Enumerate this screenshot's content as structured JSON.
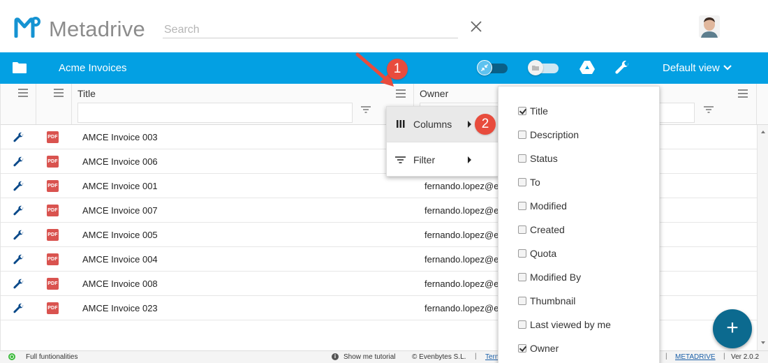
{
  "app": {
    "name": "Metadrive",
    "search_placeholder": "Search"
  },
  "toolbar": {
    "library_title": "Acme Invoices",
    "view_label": "Default view"
  },
  "grid": {
    "columns": {
      "title": "Title",
      "owner": "Owner"
    },
    "rows": [
      {
        "title": "AMCE Invoice 003",
        "owner": ""
      },
      {
        "title": "AMCE Invoice 006",
        "owner": ""
      },
      {
        "title": "AMCE Invoice 001",
        "owner": "fernando.lopez@e"
      },
      {
        "title": "AMCE Invoice 007",
        "owner": "fernando.lopez@e"
      },
      {
        "title": "AMCE Invoice 005",
        "owner": "fernando.lopez@e"
      },
      {
        "title": "AMCE Invoice 004",
        "owner": "fernando.lopez@e"
      },
      {
        "title": "AMCE Invoice 008",
        "owner": "fernando.lopez@e"
      },
      {
        "title": "AMCE Invoice 023",
        "owner": "fernando.lopez@e"
      }
    ],
    "file_badge": "PDF"
  },
  "context_menu": {
    "columns_label": "Columns",
    "filter_label": "Filter"
  },
  "columns_menu": {
    "options": [
      {
        "label": "Title",
        "checked": true
      },
      {
        "label": "Description",
        "checked": false
      },
      {
        "label": "Status",
        "checked": false
      },
      {
        "label": "To",
        "checked": false
      },
      {
        "label": "Modified",
        "checked": false
      },
      {
        "label": "Created",
        "checked": false
      },
      {
        "label": "Quota",
        "checked": false
      },
      {
        "label": "Modified By",
        "checked": false
      },
      {
        "label": "Thumbnail",
        "checked": false
      },
      {
        "label": "Last viewed by me",
        "checked": false
      },
      {
        "label": "Owner",
        "checked": true
      }
    ]
  },
  "callouts": {
    "step1": "1",
    "step2": "2"
  },
  "fab": {
    "label": "+"
  },
  "statusbar": {
    "mode": "Full funtionalities",
    "tutorial": "Show me tutorial",
    "copyright": "© Evenbytes S.L.",
    "terms": "Tern",
    "brand_link": "METADRIVE",
    "version": "Ver 2.0.2",
    "separator": "|"
  },
  "colors": {
    "toolbar_blue": "#03a0e3",
    "fab_blue": "#0c6a8f",
    "callout_red": "#e84c3d",
    "pdf_red": "#d9534f"
  }
}
